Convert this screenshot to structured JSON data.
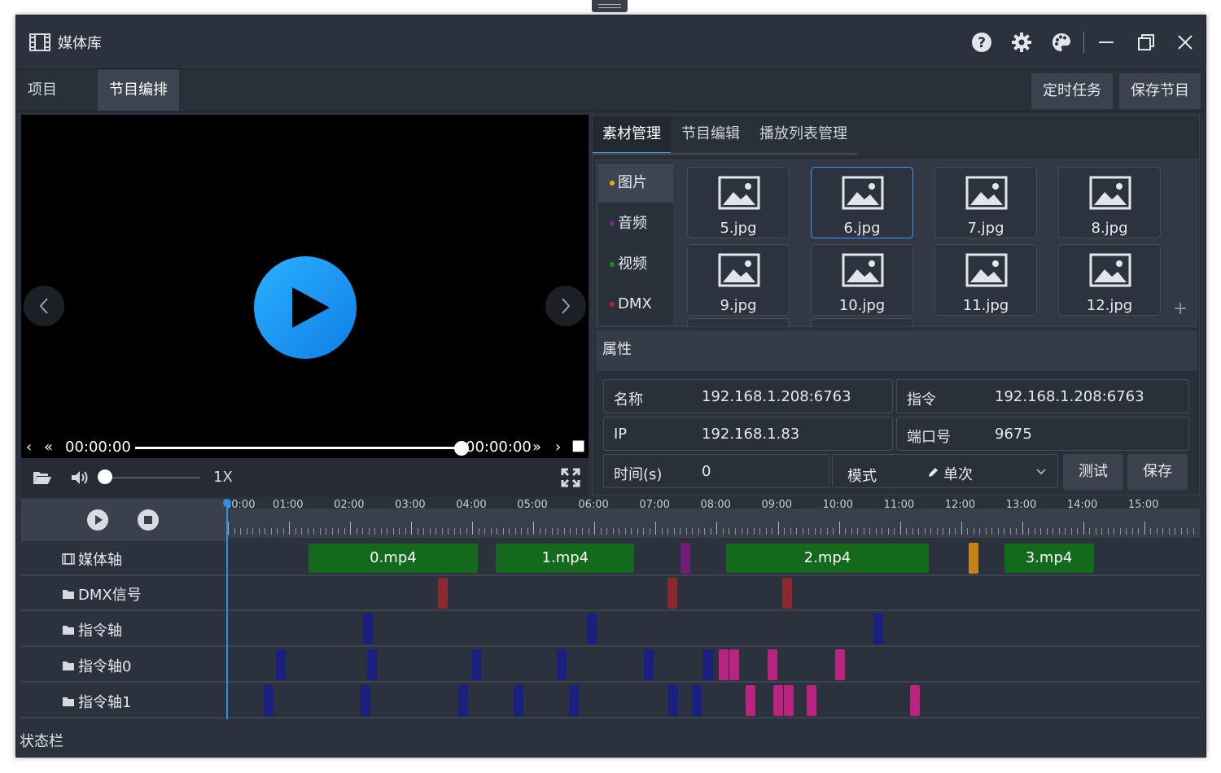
{
  "window": {
    "title": "媒体库"
  },
  "tabs": [
    {
      "label": "项目"
    },
    {
      "label": "节目编排"
    }
  ],
  "header_buttons": {
    "schedule": "定时任务",
    "save_program": "保存节目"
  },
  "player": {
    "time_current": "00:00:00",
    "time_total": "00:00:00",
    "speed": "1X",
    "progress": 1.0
  },
  "right_tabs": [
    {
      "label": "素材管理"
    },
    {
      "label": "节目编辑"
    },
    {
      "label": "播放列表管理"
    }
  ],
  "categories": [
    {
      "label": "图片",
      "color": "#f5a623"
    },
    {
      "label": "音频",
      "color": "#7b2a8c"
    },
    {
      "label": "视频",
      "color": "#1f8a2a"
    },
    {
      "label": "DMX",
      "color": "#b5282a"
    }
  ],
  "thumbnails": [
    {
      "name": "5.jpg"
    },
    {
      "name": "6.jpg"
    },
    {
      "name": "7.jpg"
    },
    {
      "name": "8.jpg"
    },
    {
      "name": "9.jpg"
    },
    {
      "name": "10.jpg"
    },
    {
      "name": "11.jpg"
    },
    {
      "name": "12.jpg"
    }
  ],
  "selected_thumbnail": "6.jpg",
  "add_symbol": "+",
  "properties": {
    "title": "属性",
    "name_label": "名称",
    "name_value": "192.168.1.208:6763",
    "cmd_label": "指令",
    "cmd_value": "192.168.1.208:6763",
    "ip_label": "IP",
    "ip_value": "192.168.1.83",
    "port_label": "端口号",
    "port_value": "9675",
    "time_label": "时间(s)",
    "time_value": "0",
    "mode_label": "模式",
    "mode_value": "单次",
    "test_button": "测试",
    "save_button": "保存"
  },
  "ruler_labels": [
    "00:00",
    "01:00",
    "02:00",
    "03:00",
    "04:00",
    "05:00",
    "06:00",
    "07:00",
    "08:00",
    "09:00",
    "10:00",
    "11:00",
    "12:00",
    "13:00",
    "14:00",
    "15:00"
  ],
  "tracks": [
    {
      "name": "媒体轴",
      "icon": "film-icon"
    },
    {
      "name": "DMX信号",
      "icon": "folder-icon"
    },
    {
      "name": "指令轴",
      "icon": "folder-icon"
    },
    {
      "name": "指令轴0",
      "icon": "folder-icon"
    },
    {
      "name": "指令轴1",
      "icon": "folder-icon"
    }
  ],
  "clips": [
    {
      "label": "0.mp4",
      "start": "01:20",
      "end": "04:06"
    },
    {
      "label": "1.mp4",
      "start": "04:24",
      "end": "06:40"
    },
    {
      "label": "2.mp4",
      "start": "08:10",
      "end": "11:29"
    },
    {
      "label": "3.mp4",
      "start": "12:43",
      "end": "14:11"
    }
  ],
  "colors": {
    "clip": "#146a1c",
    "dmx": "#8a2a2e",
    "cmd": "#1a2080",
    "cmd_alt": "#b8247f",
    "audio_marker": "#6e1e76",
    "image_marker": "#c58317",
    "accent": "#2e8de8"
  },
  "status": {
    "text": "状态栏"
  }
}
